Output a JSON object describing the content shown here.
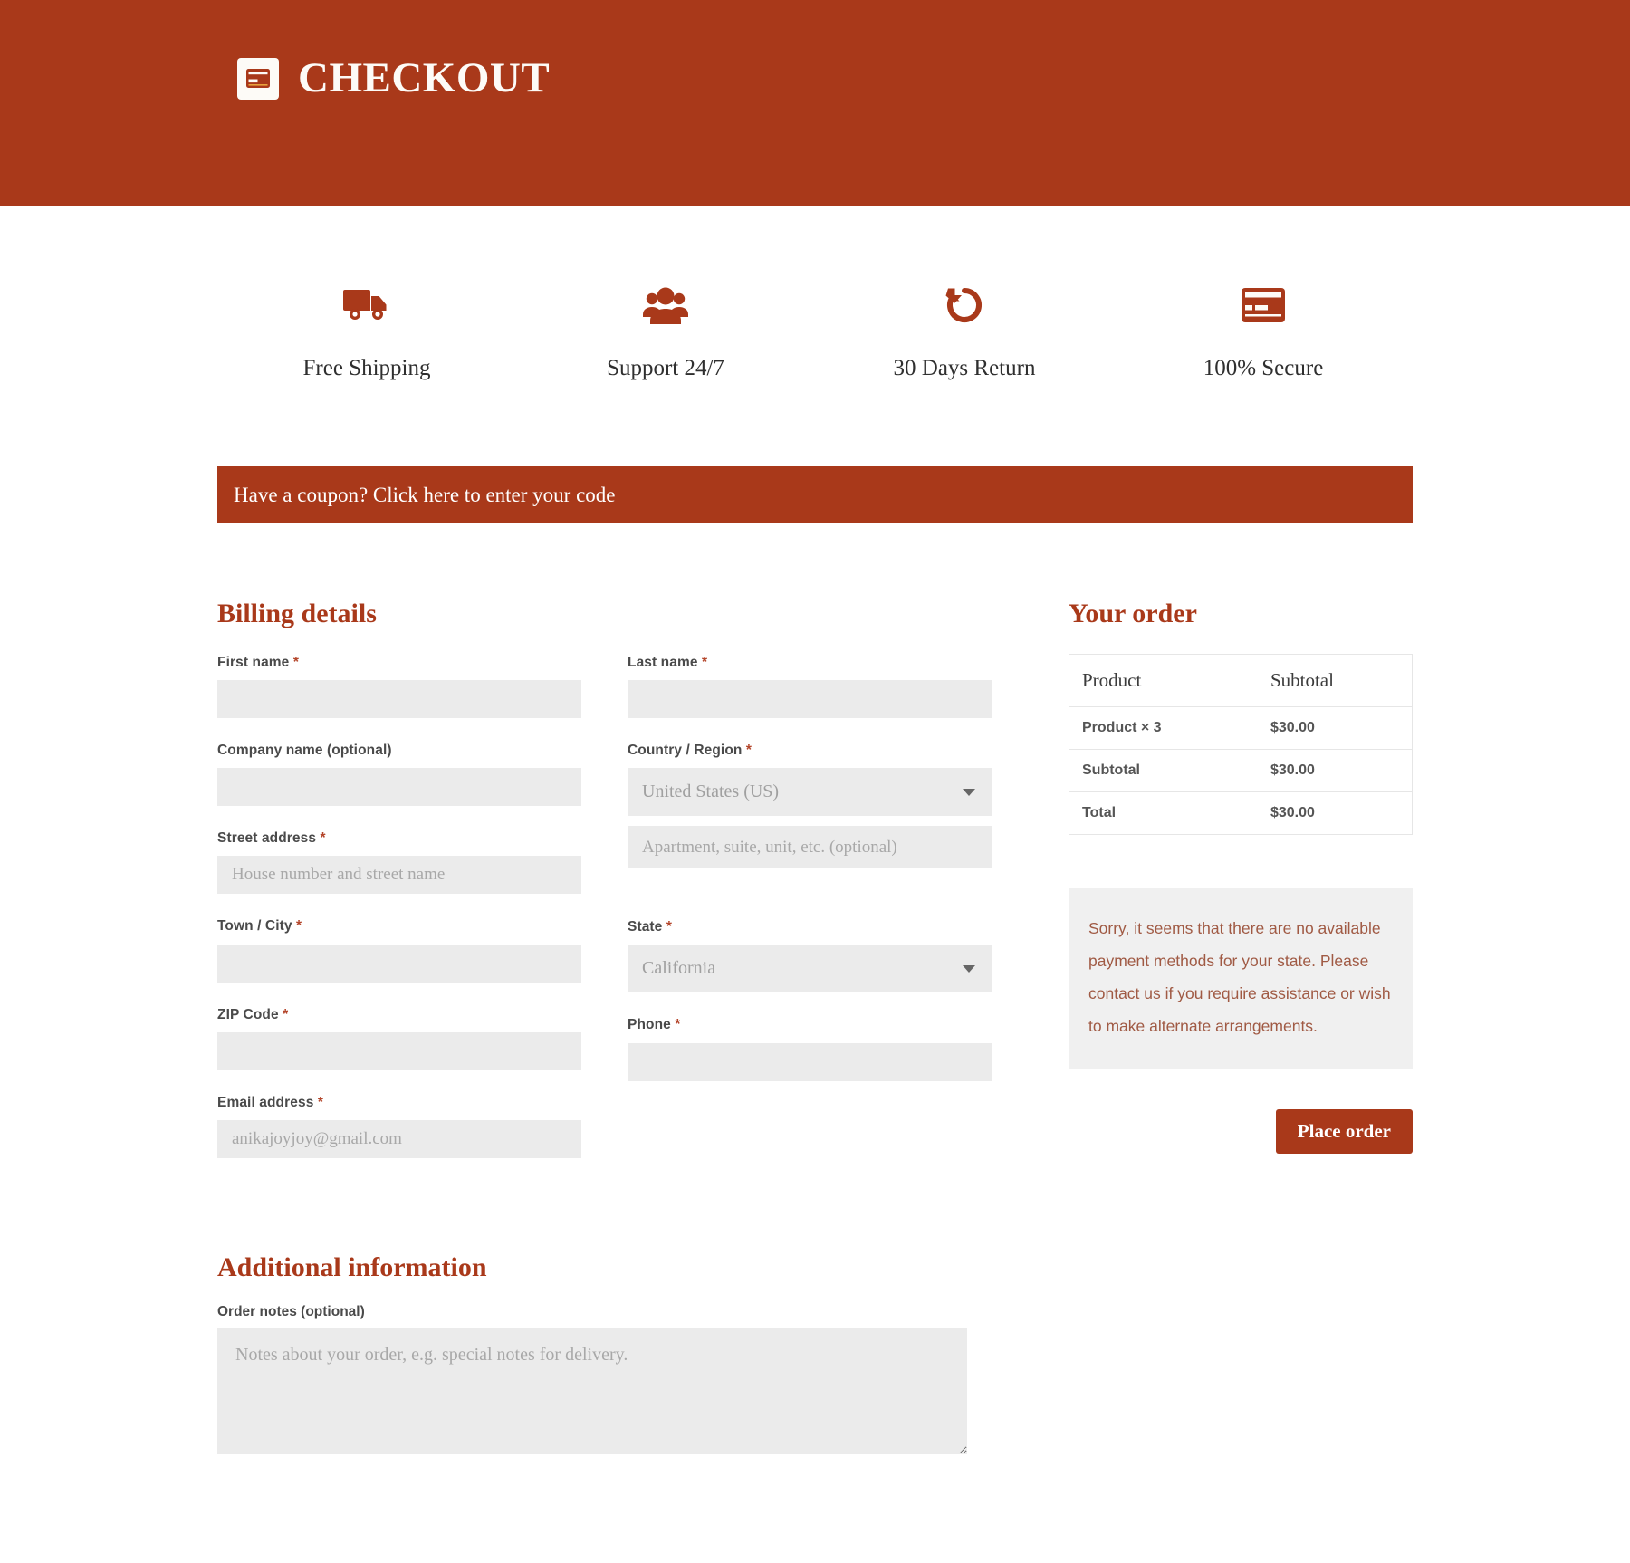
{
  "header": {
    "brand_title": "CHECKOUT",
    "logo_icon": "credit-card-icon",
    "background_color": "#a9391a"
  },
  "features": [
    {
      "icon": "truck-icon",
      "label": "Free Shipping"
    },
    {
      "icon": "users-group-icon",
      "label": "Support 24/7"
    },
    {
      "icon": "undo-arrow-icon",
      "label": "30 Days Return"
    },
    {
      "icon": "credit-card-icon",
      "label": "100% Secure"
    }
  ],
  "coupon": {
    "text": "Have a coupon? Click here to enter your code"
  },
  "billing": {
    "title": "Billing details",
    "fields": {
      "first_name": {
        "label": "First name",
        "required": true,
        "value": "",
        "placeholder": ""
      },
      "last_name": {
        "label": "Last name",
        "required": true,
        "value": "",
        "placeholder": ""
      },
      "company_name": {
        "label": "Company name (optional)",
        "required": false,
        "value": "",
        "placeholder": ""
      },
      "country": {
        "label": "Country / Region",
        "required": true,
        "value": "United States (US)"
      },
      "street_address": {
        "label": "Street address",
        "required": true,
        "value": "",
        "placeholder": "House number and street name"
      },
      "apartment": {
        "label": "",
        "required": false,
        "value": "",
        "placeholder": "Apartment, suite, unit, etc. (optional)"
      },
      "city": {
        "label": "Town / City",
        "required": true,
        "value": "",
        "placeholder": ""
      },
      "state": {
        "label": "State",
        "required": true,
        "value": "California"
      },
      "zip": {
        "label": "ZIP Code",
        "required": true,
        "value": "",
        "placeholder": ""
      },
      "phone": {
        "label": "Phone",
        "required": true,
        "value": "",
        "placeholder": ""
      },
      "email": {
        "label": "Email address",
        "required": true,
        "value": "",
        "placeholder": "anikajoyjoy@gmail.com"
      }
    }
  },
  "additional": {
    "title": "Additional information",
    "notes_label": "Order notes (optional)",
    "notes_value": "",
    "notes_placeholder": "Notes about your order, e.g. special notes for delivery."
  },
  "order": {
    "title": "Your order",
    "columns": [
      "Product",
      "Subtotal"
    ],
    "rows": [
      {
        "label": "Product  × 3",
        "value": "$30.00"
      },
      {
        "label": "Subtotal",
        "value": "$30.00"
      },
      {
        "label": "Total",
        "value": "$30.00"
      }
    ],
    "payment_notice": "Sorry, it seems that there are no available payment methods for your state. Please contact us if you require assistance or wish to make alternate arrangements.",
    "place_order_label": "Place order"
  },
  "colors": {
    "brand": "#a9391a",
    "input_bg": "#ebebeb",
    "notice_bg": "#f0f0f0",
    "notice_text": "#a05a44"
  }
}
